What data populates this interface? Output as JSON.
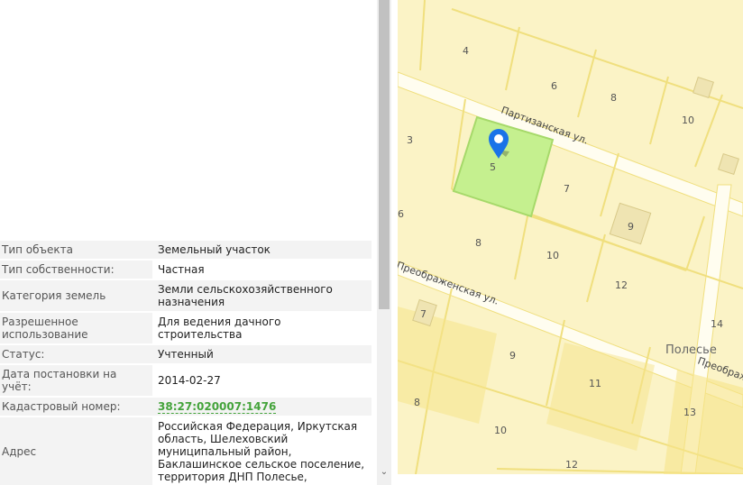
{
  "properties": [
    {
      "key": "Тип объекта",
      "value": "Земельный участок"
    },
    {
      "key": "Тип собственности:",
      "value": "Частная"
    },
    {
      "key": "Категория земель",
      "value": "Земли сельскохозяйственного назначения"
    },
    {
      "key": "Разрешенное использование",
      "value": "Для ведения дачного строительства"
    },
    {
      "key": "Статус:",
      "value": "Учтенный"
    },
    {
      "key": "Дата постановки на учёт:",
      "value": "2014-02-27"
    },
    {
      "key": "Кадастровый номер:",
      "value": "38:27:020007:1476"
    },
    {
      "key": "Адрес",
      "value": "Российская Федерация, Иркутская область, Шелеховский муниципальный район, Баклашинское сельское поселение, территория ДНП Полесье,"
    }
  ],
  "map": {
    "streets": [
      "Партизанская ул.",
      "Преображенская ул.",
      "Преображ"
    ],
    "place_name": "Полесье",
    "plot_labels": [
      "4",
      "6",
      "8",
      "10",
      "3",
      "5",
      "7",
      "6",
      "9",
      "8",
      "10",
      "12",
      "7",
      "14",
      "9",
      "11",
      "8",
      "10",
      "13",
      "12"
    ],
    "selected_plot": "5",
    "colors": {
      "background": "#fbf3c6",
      "plot_border": "#f0df7e",
      "selected_plot": "#c5f08f",
      "road": "#fffdf0",
      "marker": "#1a73e8"
    },
    "icons": [
      "map-pin-icon",
      "chevron-down-icon"
    ]
  }
}
